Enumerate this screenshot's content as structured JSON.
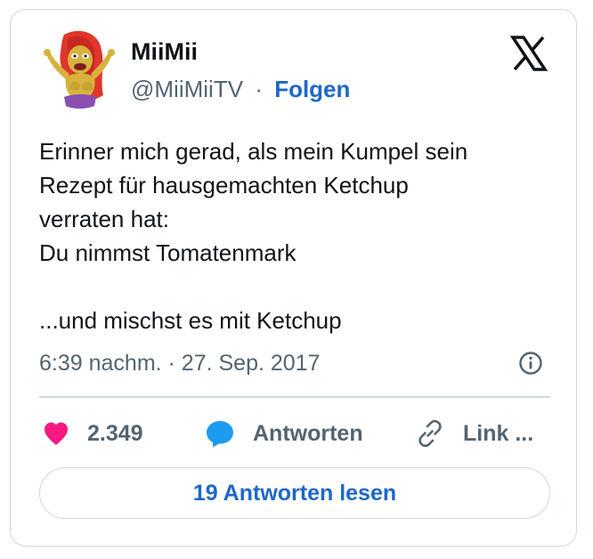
{
  "author": {
    "display_name": "MiiMii",
    "handle": "@MiiMiiTV",
    "separator": "·",
    "follow_label": "Folgen"
  },
  "logo": {
    "icon": "x-logo-icon"
  },
  "tweet": {
    "lines": [
      "Erinner mich gerad, als mein Kumpel sein",
      "Rezept für hausgemachten Ketchup",
      "verraten hat:",
      "Du nimmst Tomatenmark",
      "",
      "...und mischst es mit Ketchup"
    ],
    "timestamp": "6:39 nachm. · 27. Sep. 2017"
  },
  "actions": {
    "like_count": "2.349",
    "reply_label": "Antworten",
    "link_label": "Link ..."
  },
  "read_replies_label": "19 Antworten lesen",
  "colors": {
    "accent": "#1d68c8",
    "like": "#f91880",
    "reply": "#1d9bf0",
    "muted": "#536471",
    "border": "#cfd9de",
    "text": "#0f1419"
  }
}
